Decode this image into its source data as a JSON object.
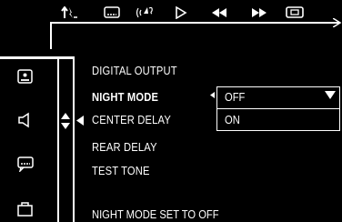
{
  "toolbar": {
    "icons": [
      "audio-settings-icon",
      "subtitle-icon",
      "audio-icon",
      "play-icon",
      "rewind-icon",
      "fast-forward-icon",
      "display-icon"
    ]
  },
  "sidebar": {
    "icons": [
      "display-setup-icon",
      "speaker-icon",
      "subtitle-setup-icon",
      "lock-icon"
    ]
  },
  "menu": {
    "items": [
      {
        "label": "DIGITAL OUTPUT"
      },
      {
        "label": "NIGHT MODE"
      },
      {
        "label": "CENTER DELAY"
      },
      {
        "label": "REAR DELAY"
      },
      {
        "label": "TEST TONE"
      }
    ],
    "selected_index": 1
  },
  "dropdown": {
    "options": [
      "OFF",
      "ON"
    ],
    "selected": "OFF"
  },
  "status": {
    "text": "NIGHT MODE SET TO OFF"
  }
}
